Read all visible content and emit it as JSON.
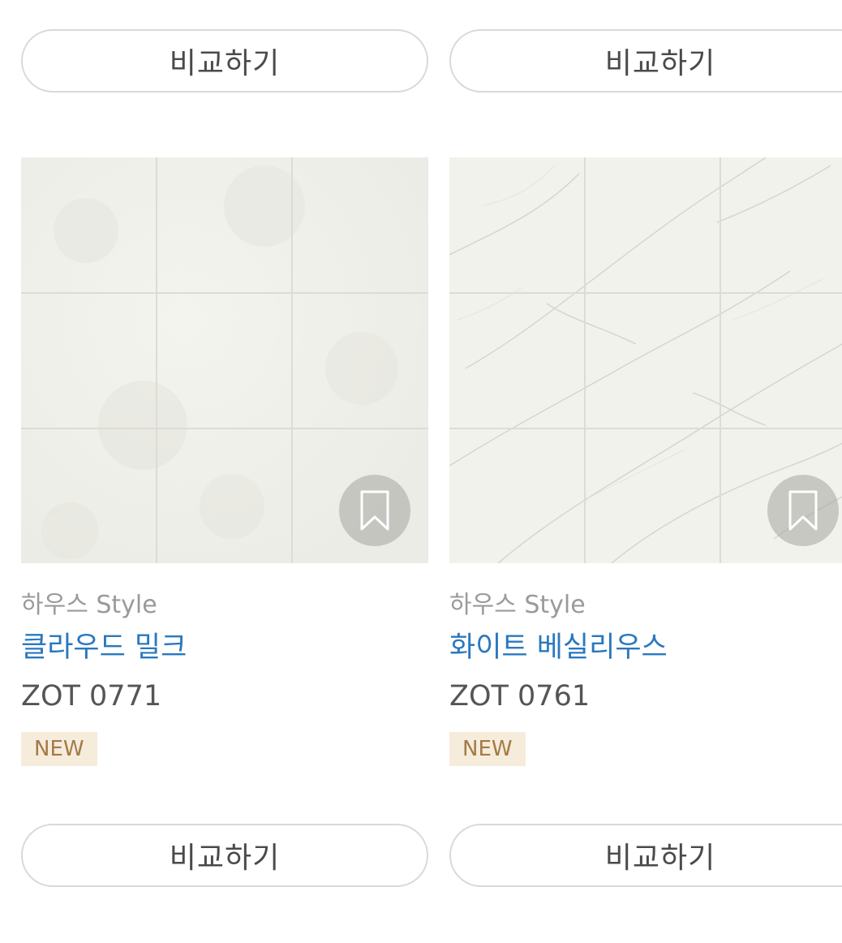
{
  "products": [
    {
      "brand": "하우스 Style",
      "name": "클라우드 밀크",
      "code": "ZOT 0771",
      "badge": "NEW",
      "compare_label_top": "비교하기",
      "compare_label_bottom": "비교하기"
    },
    {
      "brand": "하우스 Style",
      "name": "화이트 베실리우스",
      "code": "ZOT 0761",
      "badge": "NEW",
      "compare_label_top": "비교하기",
      "compare_label_bottom": "비교하기"
    }
  ],
  "colors": {
    "product_name": "#2a78bf",
    "brand_text": "#9a9a9a",
    "badge_bg": "#f6ecdc",
    "badge_text": "#a47a45",
    "button_border": "#d9d9d9"
  },
  "icons": {
    "bookmark": "bookmark-icon"
  }
}
